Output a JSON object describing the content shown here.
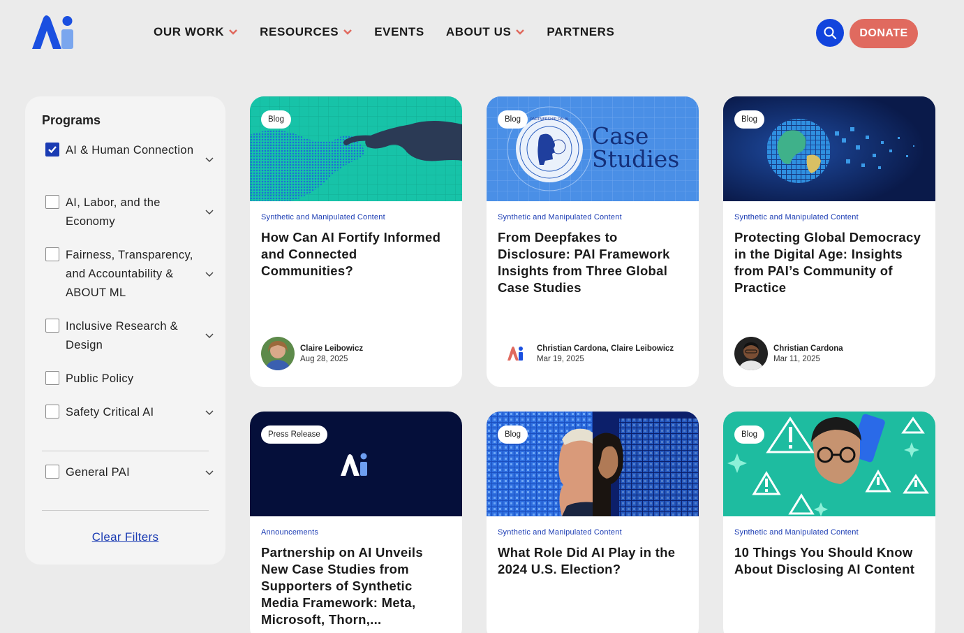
{
  "header": {
    "nav": [
      {
        "label": "OUR WORK",
        "has_dropdown": true
      },
      {
        "label": "RESOURCES",
        "has_dropdown": true
      },
      {
        "label": "EVENTS",
        "has_dropdown": false
      },
      {
        "label": "ABOUT US",
        "has_dropdown": true
      },
      {
        "label": "PARTNERS",
        "has_dropdown": false
      }
    ],
    "donate_label": "DONATE",
    "logo_text": "Ai"
  },
  "sidebar": {
    "title": "Programs",
    "filters": [
      {
        "label": "AI & Human Connection",
        "checked": true
      },
      {
        "label": "AI, Labor, and the Economy",
        "checked": false
      },
      {
        "label": "Fairness, Transparency, and Accountability & ABOUT ML",
        "checked": false
      },
      {
        "label": "Inclusive Research & Design",
        "checked": false
      },
      {
        "label": "Public Policy",
        "checked": false
      },
      {
        "label": "Safety Critical AI",
        "checked": false
      },
      {
        "label": "General PAI",
        "checked": false
      }
    ],
    "clear_label": "Clear Filters"
  },
  "cards": [
    {
      "tag": "Blog",
      "category": "Synthetic and Manipulated Content",
      "title": "How Can AI Fortify Informed and Connected Communities?",
      "author": "Claire Leibowicz",
      "date": "Aug 28, 2025"
    },
    {
      "tag": "Blog",
      "category": "Synthetic and Manipulated Content",
      "title": "From Deepfakes to Disclosure: PAI Framework Insights from Three Global Case Studies",
      "author": "Christian Cardona, Claire Leibowicz",
      "date": "Mar 19, 2025",
      "image_text": "Case Studies",
      "seal_text": "PARTNERSHIP ON AI"
    },
    {
      "tag": "Blog",
      "category": "Synthetic and Manipulated Content",
      "title": "Protecting Global Democracy in the Digital Age: Insights from PAI’s Community of Practice",
      "author": "Christian Cardona",
      "date": "Mar 11, 2025"
    },
    {
      "tag": "Press Release",
      "category": "Announcements",
      "title": "Partnership on AI Unveils New Case Studies from Supporters of Synthetic Media Framework: Meta, Microsoft, Thorn,..."
    },
    {
      "tag": "Blog",
      "category": "Synthetic and Manipulated Content",
      "title": "What Role Did AI Play in the 2024 U.S. Election?"
    },
    {
      "tag": "Blog",
      "category": "Synthetic and Manipulated Content",
      "title": "10 Things You Should Know About Disclosing AI Content"
    }
  ],
  "colors": {
    "accent": "#1a3bb3",
    "donate": "#e06a5f",
    "background": "#ebebeb",
    "search": "#1144dd"
  }
}
